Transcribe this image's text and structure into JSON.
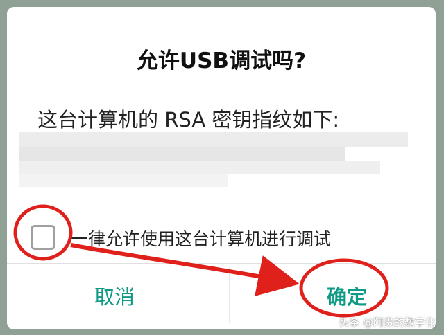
{
  "dialog": {
    "title": "允许USB调试吗?",
    "message": "这台计算机的 RSA 密钥指纹如下:",
    "always_allow_label": "一律允许使用这台计算机进行调试",
    "always_allow_checked": false,
    "cancel_label": "取消",
    "ok_label": "确定"
  },
  "colors": {
    "accent": "#0e9a85",
    "annotation_red": "#e0201b",
    "background": "#8fa095"
  },
  "watermark": "头条 @阿贵的数字化"
}
